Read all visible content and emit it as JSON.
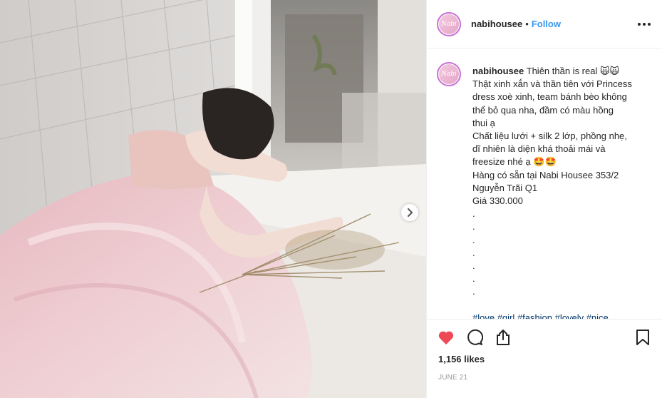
{
  "colors": {
    "link": "#3897f0",
    "hashtag": "#003569",
    "heart": "#ed4956",
    "muted": "#999999",
    "text": "#262626"
  },
  "post": {
    "username": "nabihousee",
    "avatar_text": "Nabi",
    "follow_label": "Follow",
    "separator": "•",
    "caption": {
      "username": "nabihousee",
      "lines": [
        "Thiên thần is real 🙀🙀",
        "Thật xinh xắn và thần tiên với Princess",
        "dress xoè xinh, team bánh bèo không",
        "thể bỏ qua nha, đầm có màu hồng",
        "thui ạ",
        "Chất liệu lưới + silk 2 lớp, phồng nhẹ,",
        "dĩ nhiên là diện khá thoải mái và",
        "freesize nhé ạ 🤩🤩",
        "Hàng có sẵn tại Nabi Housee 353/2",
        "Nguyễn Trãi Q1",
        "Giá 330.000",
        ".",
        ".",
        ".",
        ".",
        ".",
        ".",
        "."
      ],
      "hashtags": "#love #girl #fashion #lovely #nice"
    },
    "likes": "1,156 likes",
    "date": "JUNE 21",
    "icons": {
      "like": "heart-icon",
      "comment": "comment-icon",
      "share": "share-icon",
      "save": "bookmark-icon",
      "more": "more-icon",
      "next": "chevron-right-icon"
    }
  }
}
